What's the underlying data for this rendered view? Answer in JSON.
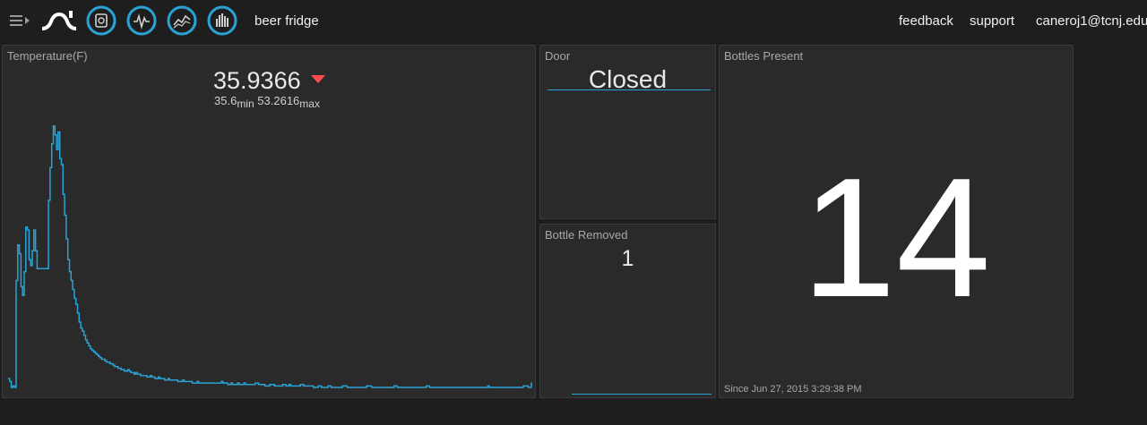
{
  "header": {
    "menu_icon": "hamburger-menu-icon",
    "logo_icon": "wave-logo-icon",
    "nav_icons": [
      "dashboard-icon",
      "waveform-icon",
      "line-chart-icon",
      "bar-chart-icon"
    ],
    "dashboard_title": "beer fridge",
    "links": {
      "feedback": "feedback",
      "support": "support",
      "user": "caneroj1@tcnj.edu"
    },
    "accent_color": "#29a3d6"
  },
  "temperature_panel": {
    "title": "Temperature(F)",
    "current_value": "35.9366",
    "trend": "down",
    "trend_color": "#ff4d4d",
    "min_value": "35.6",
    "min_label": "min",
    "max_value": "53.2616",
    "max_label": "max",
    "chart_data": {
      "type": "line",
      "series": [
        {
          "color": "#29a3d6",
          "values": [
            36.2,
            36,
            35.6,
            35.7,
            35.6,
            42.8,
            45.2,
            44.6,
            42.4,
            41.8,
            43.4,
            46.4,
            46.2,
            44.2,
            43.8,
            44.8,
            46.2,
            44.8,
            43.6,
            43.6,
            43.6,
            43.6,
            43.6,
            43.6,
            43.6,
            48.2,
            50.4,
            52,
            53.2,
            52.6,
            51.6,
            52.8,
            51,
            50.6,
            48.6,
            47.2,
            45.6,
            44.2,
            43.4,
            42.8,
            42.2,
            41.6,
            41.2,
            40.6,
            40,
            39.6,
            39.4,
            39.1,
            38.8,
            38.6,
            38.4,
            38.2,
            38.1,
            38,
            37.9,
            37.8,
            37.7,
            37.6,
            37.5,
            37.5,
            37.4,
            37.3,
            37.3,
            37.2,
            37.2,
            37.1,
            37,
            37,
            36.9,
            36.9,
            36.8,
            36.8,
            36.7,
            36.7,
            36.8,
            36.7,
            36.6,
            36.6,
            36.5,
            36.6,
            36.5,
            36.5,
            36.4,
            36.4,
            36.4,
            36.4,
            36.3,
            36.3,
            36.4,
            36.3,
            36.3,
            36.2,
            36.2,
            36.3,
            36.2,
            36.2,
            36.2,
            36.1,
            36.1,
            36.2,
            36.1,
            36.1,
            36.1,
            36.1,
            36.1,
            36,
            36,
            36,
            36.1,
            36,
            36,
            36,
            36,
            36,
            35.9,
            35.9,
            35.9,
            36,
            35.9,
            35.9,
            35.9,
            35.9,
            35.9,
            35.9,
            35.9,
            35.9,
            35.9,
            35.9,
            35.9,
            35.9,
            35.9,
            35.9,
            36,
            35.9,
            35.9,
            35.9,
            35.8,
            35.8,
            35.9,
            35.8,
            35.8,
            35.8,
            35.9,
            35.8,
            35.8,
            35.8,
            35.9,
            35.8,
            35.8,
            35.8,
            35.8,
            35.8,
            35.8,
            35.9,
            35.9,
            35.8,
            35.8,
            35.8,
            35.8,
            35.7,
            35.7,
            35.7,
            35.8,
            35.8,
            35.8,
            35.7,
            35.7,
            35.7,
            35.7,
            35.7,
            35.8,
            35.8,
            35.7,
            35.7,
            35.8,
            35.7,
            35.7,
            35.7,
            35.7,
            35.7,
            35.7,
            35.8,
            35.8,
            35.7,
            35.7,
            35.7,
            35.7,
            35.7,
            35.7,
            35.6,
            35.6,
            35.6,
            35.7,
            35.7,
            35.6,
            35.6,
            35.6,
            35.6,
            35.7,
            35.7,
            35.6,
            35.6,
            35.6,
            35.6,
            35.6,
            35.6,
            35.6,
            35.7,
            35.7,
            35.7,
            35.6,
            35.6,
            35.6,
            35.6,
            35.6,
            35.6,
            35.6,
            35.6,
            35.6,
            35.6,
            35.6,
            35.6,
            35.7,
            35.7,
            35.7,
            35.6,
            35.6,
            35.6,
            35.6,
            35.6,
            35.6,
            35.6,
            35.6,
            35.6,
            35.6,
            35.6,
            35.6,
            35.6,
            35.6,
            35.7,
            35.7,
            35.6,
            35.6,
            35.6,
            35.6,
            35.6,
            35.6,
            35.6,
            35.6,
            35.6,
            35.6,
            35.6,
            35.6,
            35.6,
            35.6,
            35.6,
            35.6,
            35.6,
            35.6,
            35.7,
            35.7,
            35.6,
            35.6,
            35.6,
            35.6,
            35.6,
            35.6,
            35.6,
            35.6,
            35.6,
            35.6,
            35.6,
            35.6,
            35.6,
            35.6,
            35.6,
            35.6,
            35.6,
            35.6,
            35.6,
            35.6,
            35.6,
            35.6,
            35.6,
            35.6,
            35.6,
            35.6,
            35.6,
            35.6,
            35.6,
            35.6,
            35.6,
            35.6,
            35.6,
            35.6,
            35.6,
            35.6,
            35.7,
            35.6,
            35.6,
            35.6,
            35.6,
            35.6,
            35.6,
            35.6,
            35.6,
            35.6,
            35.6,
            35.6,
            35.6,
            35.6,
            35.6,
            35.6,
            35.6,
            35.6,
            35.6,
            35.6,
            35.6,
            35.6,
            35.7,
            35.7,
            35.7,
            35.6,
            35.6,
            35.9366
          ]
        }
      ],
      "ylim": [
        35.0,
        55.0
      ],
      "step": true
    }
  },
  "door_panel": {
    "title": "Door",
    "state": "Closed"
  },
  "bottle_removed_panel": {
    "title": "Bottle Removed",
    "value": "1"
  },
  "bottles_present_panel": {
    "title": "Bottles Present",
    "value": "14",
    "since": "Since Jun 27, 2015 3:29:38 PM"
  }
}
